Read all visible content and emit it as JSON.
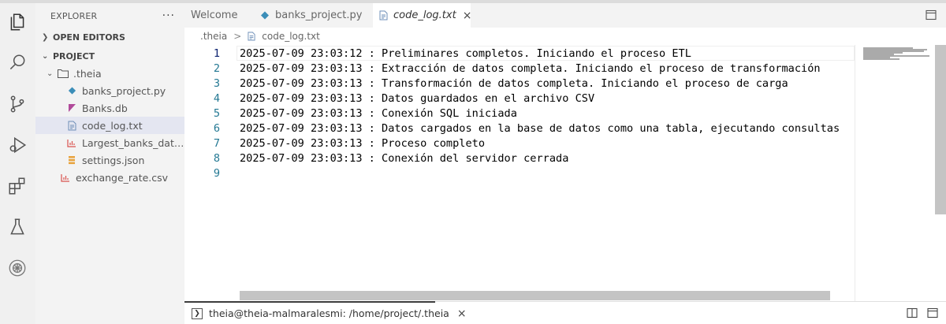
{
  "explorer": {
    "title": "EXPLORER",
    "more": "···",
    "open_editors": "OPEN EDITORS",
    "project": "PROJECT",
    "tree": [
      {
        "label": ".theia",
        "indent": 1,
        "kind": "folder",
        "expanded": true
      },
      {
        "label": "banks_project.py",
        "indent": 2,
        "kind": "python"
      },
      {
        "label": "Banks.db",
        "indent": 2,
        "kind": "db"
      },
      {
        "label": "code_log.txt",
        "indent": 2,
        "kind": "text",
        "selected": true
      },
      {
        "label": "Largest_banks_data...",
        "indent": 2,
        "kind": "csv"
      },
      {
        "label": "settings.json",
        "indent": 2,
        "kind": "json"
      },
      {
        "label": "exchange_rate.csv",
        "indent": 1,
        "kind": "csv"
      }
    ]
  },
  "tabs": [
    {
      "label": "Welcome",
      "kind": "none",
      "active": false
    },
    {
      "label": "banks_project.py",
      "kind": "python",
      "active": false
    },
    {
      "label": "code_log.txt",
      "kind": "text",
      "active": true,
      "close": "×"
    }
  ],
  "breadcrumb": {
    "folder": ".theia",
    "sep": ">",
    "file": "code_log.txt"
  },
  "editor": {
    "current_line": 1,
    "lines": [
      {
        "n": "1",
        "text": "2025-07-09 23:03:12 : Preliminares completos. Iniciando el proceso ETL"
      },
      {
        "n": "2",
        "text": "2025-07-09 23:03:13 : Extracción de datos completa. Iniciando el proceso de transformación"
      },
      {
        "n": "3",
        "text": "2025-07-09 23:03:13 : Transformación de datos completa. Iniciando el proceso de carga"
      },
      {
        "n": "4",
        "text": "2025-07-09 23:03:13 : Datos guardados en el archivo CSV"
      },
      {
        "n": "5",
        "text": "2025-07-09 23:03:13 : Conexión SQL iniciada"
      },
      {
        "n": "6",
        "text": "2025-07-09 23:03:13 : Datos cargados en la base de datos como una tabla, ejecutando consultas"
      },
      {
        "n": "7",
        "text": "2025-07-09 23:03:13 : Proceso completo"
      },
      {
        "n": "8",
        "text": "2025-07-09 23:03:13 : Conexión del servidor cerrada"
      },
      {
        "n": "9",
        "text": ""
      }
    ]
  },
  "terminal": {
    "label": "theia@theia-malmaralesmi: /home/project/.theia",
    "close": "×"
  },
  "colors": {
    "python": "#3b8eb8",
    "db": "#b14a9a",
    "text": "#6e8fb8",
    "csv": "#d9534f",
    "json": "#e8a33d",
    "line_number": "#237893",
    "selection": "#e4e6f1"
  },
  "icons": {
    "activity": [
      "files-icon",
      "search-icon",
      "source-control-icon",
      "run-debug-icon",
      "extensions-icon",
      "testing-icon",
      "skills-network-icon"
    ]
  }
}
